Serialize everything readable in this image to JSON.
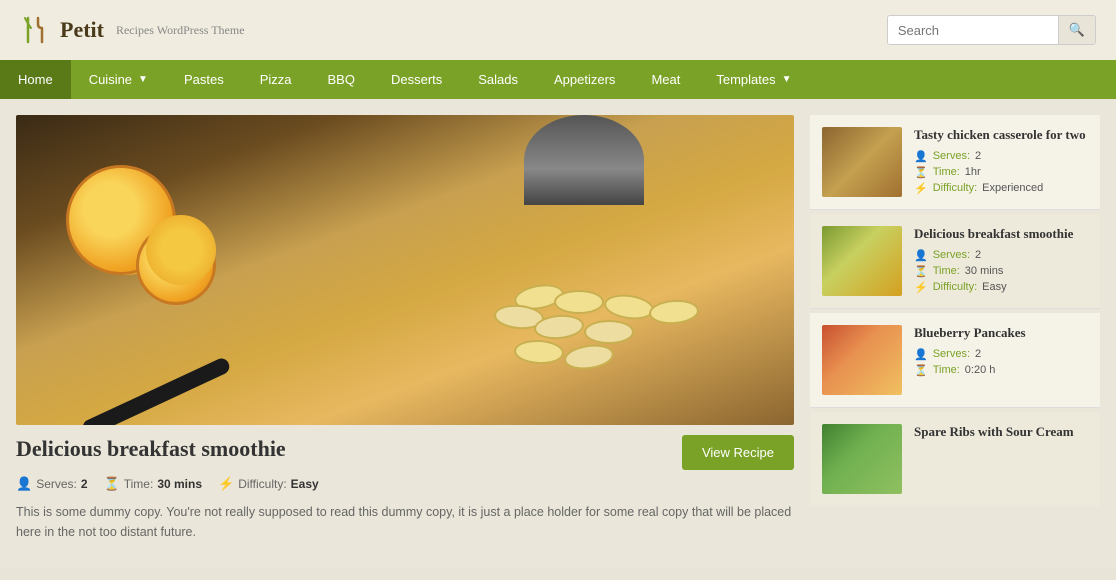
{
  "header": {
    "logo_title": "Petit",
    "logo_subtitle": "Recipes WordPress Theme",
    "search_placeholder": "Search"
  },
  "nav": {
    "items": [
      {
        "label": "Home",
        "active": true,
        "has_arrow": false
      },
      {
        "label": "Cuisine",
        "active": false,
        "has_arrow": true
      },
      {
        "label": "Pastes",
        "active": false,
        "has_arrow": false
      },
      {
        "label": "Pizza",
        "active": false,
        "has_arrow": false
      },
      {
        "label": "BBQ",
        "active": false,
        "has_arrow": false
      },
      {
        "label": "Desserts",
        "active": false,
        "has_arrow": false
      },
      {
        "label": "Salads",
        "active": false,
        "has_arrow": false
      },
      {
        "label": "Appetizers",
        "active": false,
        "has_arrow": false
      },
      {
        "label": "Meat",
        "active": false,
        "has_arrow": false
      },
      {
        "label": "Templates",
        "active": false,
        "has_arrow": true
      }
    ]
  },
  "main_article": {
    "title": "Delicious breakfast smoothie",
    "view_recipe_label": "View Recipe",
    "serves_label": "Serves:",
    "serves_value": "2",
    "time_label": "Time:",
    "time_value": "30 mins",
    "difficulty_label": "Difficulty:",
    "difficulty_value": "Easy",
    "description": "This is some dummy copy. You're not really supposed to read this dummy copy, it is just a place holder for some real copy that will be placed here in the not too distant future."
  },
  "sidebar": {
    "cards": [
      {
        "title": "Tasty chicken casserole for two",
        "serves_label": "Serves:",
        "serves_value": "2",
        "time_label": "Time:",
        "time_value": "1hr",
        "difficulty_label": "Difficulty:",
        "difficulty_value": "Experienced",
        "thumb_class": "thumb-bg-1"
      },
      {
        "title": "Delicious breakfast smoothie",
        "serves_label": "Serves:",
        "serves_value": "2",
        "time_label": "Time:",
        "time_value": "30 mins",
        "difficulty_label": "Difficulty:",
        "difficulty_value": "Easy",
        "thumb_class": "thumb-bg-2"
      },
      {
        "title": "Blueberry Pancakes",
        "serves_label": "Serves:",
        "serves_value": "2",
        "time_label": "Time:",
        "time_value": "0:20 h",
        "difficulty_label": "",
        "difficulty_value": "",
        "thumb_class": "thumb-bg-3"
      },
      {
        "title": "Spare Ribs with Sour Cream",
        "serves_label": "",
        "serves_value": "",
        "time_label": "",
        "time_value": "",
        "difficulty_label": "",
        "difficulty_value": "",
        "thumb_class": "thumb-bg-4"
      }
    ]
  }
}
